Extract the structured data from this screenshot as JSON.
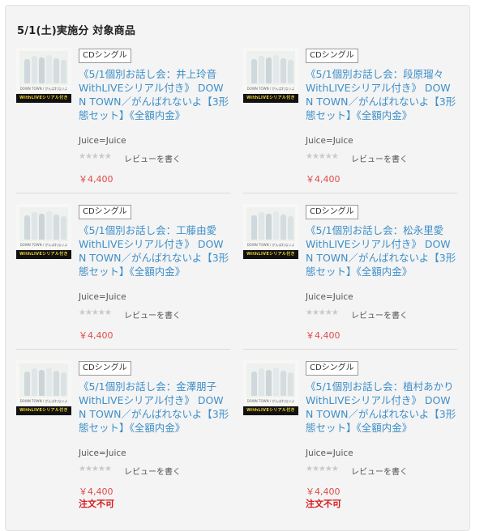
{
  "section": {
    "heading": "5/1(土)実施分 対象商品"
  },
  "thumb": {
    "strip_text": "WithLIVEシリアル付き",
    "sub_text": "DOWN TOWN / がんばれないよ"
  },
  "products": [
    {
      "badge": "CDシングル",
      "title": "《5/1個別お話し会：井上玲音 WithLIVEシリアル付き》 DOWN TOWN／がんばれないよ【3形態セット】《全額内金》",
      "artist": "Juice=Juice",
      "rating": 0,
      "review_label": "レビューを書く",
      "price": "￥4,400",
      "note": ""
    },
    {
      "badge": "CDシングル",
      "title": "《5/1個別お話し会：段原瑠々 WithLIVEシリアル付き》 DOWN TOWN／がんばれないよ【3形態セット】《全額内金》",
      "artist": "Juice=Juice",
      "rating": 0,
      "review_label": "レビューを書く",
      "price": "￥4,400",
      "note": ""
    },
    {
      "badge": "CDシングル",
      "title": "《5/1個別お話し会：工藤由愛 WithLIVEシリアル付き》 DOWN TOWN／がんばれないよ【3形態セット】《全額内金》",
      "artist": "Juice=Juice",
      "rating": 0,
      "review_label": "レビューを書く",
      "price": "￥4,400",
      "note": ""
    },
    {
      "badge": "CDシングル",
      "title": "《5/1個別お話し会：松永里愛 WithLIVEシリアル付き》 DOWN TOWN／がんばれないよ【3形態セット】《全額内金》",
      "artist": "Juice=Juice",
      "rating": 0,
      "review_label": "レビューを書く",
      "price": "￥4,400",
      "note": ""
    },
    {
      "badge": "CDシングル",
      "title": "《5/1個別お話し会：金澤朋子 WithLIVEシリアル付き》 DOWN TOWN／がんばれないよ【3形態セット】《全額内金》",
      "artist": "Juice=Juice",
      "rating": 0,
      "review_label": "レビューを書く",
      "price": "￥4,400",
      "note": "注文不可"
    },
    {
      "badge": "CDシングル",
      "title": "《5/1個別お話し会：植村あかり　WithLIVEシリアル付き》 DOWN TOWN／がんばれないよ【3形態セット】《全額内金》",
      "artist": "Juice=Juice",
      "rating": 0,
      "review_label": "レビューを書く",
      "price": "￥4,400",
      "note": "注文不可"
    }
  ],
  "colors": {
    "link": "#3d8fc9",
    "price": "#e24a4a",
    "alert": "#d7191c"
  }
}
